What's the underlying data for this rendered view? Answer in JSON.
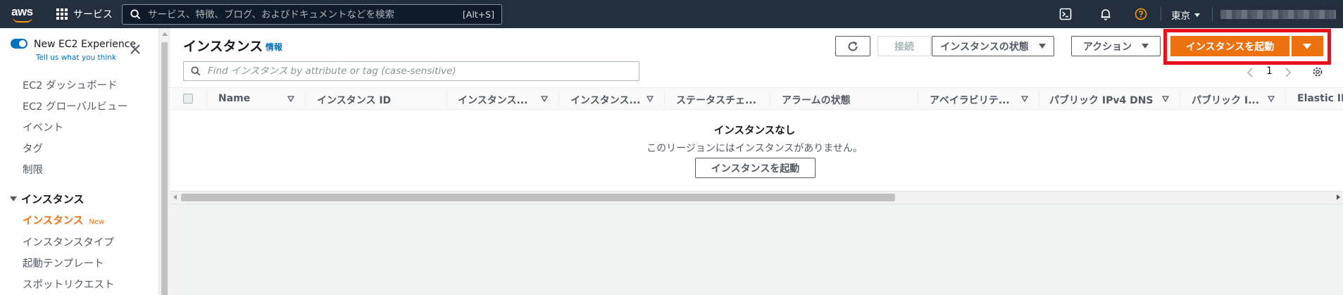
{
  "topnav": {
    "logo_text": "aws",
    "services_label": "サービス",
    "search_placeholder": "サービス、特徴、ブログ、およびドキュメントなどを検索",
    "search_shortcut": "[Alt+S]",
    "region_label": "東京",
    "icons": [
      "cloudshell-icon",
      "bell-icon",
      "help-icon"
    ],
    "accent_color": "#ff9900"
  },
  "sidebar": {
    "experience_title": "New EC2 Experience",
    "experience_link": "Tell us what you think",
    "links": [
      "EC2 ダッシュボード",
      "EC2 グローバルビュー",
      "イベント",
      "タグ",
      "制限"
    ],
    "section_title": "インスタンス",
    "section_items": [
      {
        "label": "インスタンス",
        "badge": "New"
      },
      {
        "label": "インスタンスタイプ"
      },
      {
        "label": "起動テンプレート"
      },
      {
        "label": "スポットリクエスト"
      }
    ]
  },
  "main": {
    "title": "インスタンス",
    "info_link": "情報",
    "buttons": {
      "connect": "接続",
      "instance_state": "インスタンスの状態",
      "actions": "アクション",
      "launch": "インスタンスを起動"
    },
    "filter_placeholder": "Find インスタンス by attribute or tag (case-sensitive)",
    "pagination": {
      "page": "1"
    },
    "columns": [
      "Name",
      "インスタンス ID",
      "インスタンス...",
      "インスタンス...",
      "ステータスチェ...",
      "アラームの状態",
      "アベイラビリテ...",
      "パブリック IPv4 DNS",
      "パブリック I...",
      "Elastic IP"
    ],
    "empty_title": "インスタンスなし",
    "empty_desc": "このリージョンにはインスタンスがありません。",
    "empty_launch": "インスタンスを起動"
  }
}
